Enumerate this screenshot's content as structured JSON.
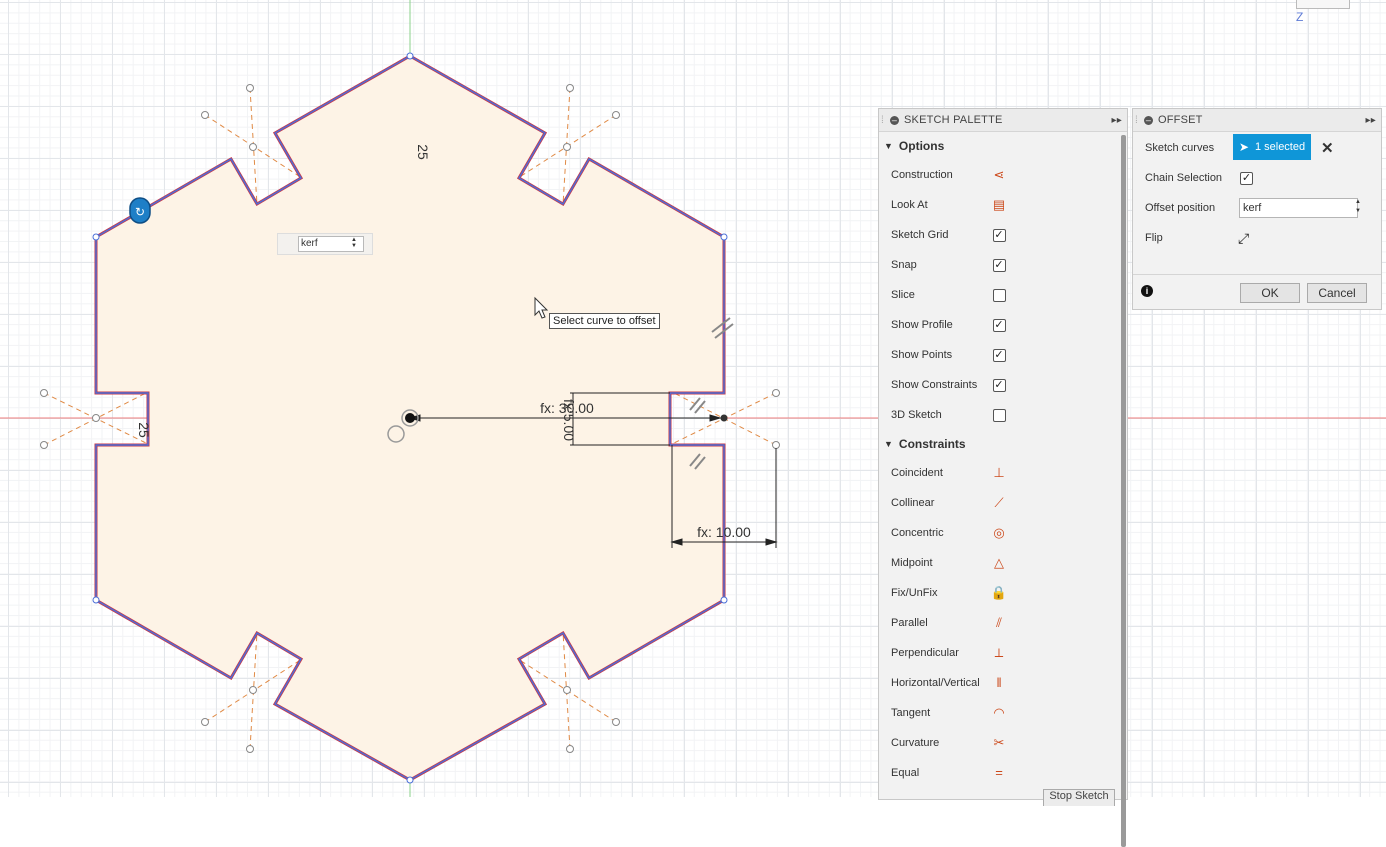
{
  "viewport": {
    "sketch_profile": "hexagonal-kerf-sketch",
    "dimension_top": "25",
    "dimension_left": "25",
    "dimension_horizontal": "fx: 30.00",
    "dimension_vertical": "fx:5.00",
    "dimension_bottom": "fx: 10.00",
    "tooltip": "Select curve to offset",
    "inline_input_value": "kerf",
    "view_cube_label": "Z"
  },
  "sketch_palette": {
    "title": "SKETCH PALETTE",
    "options_header": "Options",
    "options": [
      {
        "label": "Construction",
        "icon": "construction-icon",
        "glyph": "⋖"
      },
      {
        "label": "Look At",
        "icon": "look-at-icon",
        "glyph": "▤"
      },
      {
        "label": "Sketch Grid",
        "checked": true
      },
      {
        "label": "Snap",
        "checked": true
      },
      {
        "label": "Slice",
        "checked": false
      },
      {
        "label": "Show Profile",
        "checked": true
      },
      {
        "label": "Show Points",
        "checked": true
      },
      {
        "label": "Show Constraints",
        "checked": true
      },
      {
        "label": "3D Sketch",
        "checked": false
      }
    ],
    "constraints_header": "Constraints",
    "constraints": [
      {
        "label": "Coincident",
        "icon": "coincident-icon",
        "glyph": "⊥"
      },
      {
        "label": "Collinear",
        "icon": "collinear-icon",
        "glyph": "⟋"
      },
      {
        "label": "Concentric",
        "icon": "concentric-icon",
        "glyph": "◎"
      },
      {
        "label": "Midpoint",
        "icon": "midpoint-icon",
        "glyph": "△"
      },
      {
        "label": "Fix/UnFix",
        "icon": "lock-icon",
        "glyph": "🔒"
      },
      {
        "label": "Parallel",
        "icon": "parallel-icon",
        "glyph": "⫽"
      },
      {
        "label": "Perpendicular",
        "icon": "perpendicular-icon",
        "glyph": "⟂"
      },
      {
        "label": "Horizontal/Vertical",
        "icon": "horizontal-vertical-icon",
        "glyph": "‖"
      },
      {
        "label": "Tangent",
        "icon": "tangent-icon",
        "glyph": "◠"
      },
      {
        "label": "Curvature",
        "icon": "curvature-icon",
        "glyph": "✂"
      },
      {
        "label": "Equal",
        "icon": "equal-icon",
        "glyph": "="
      }
    ],
    "stop_button": "Stop Sketch"
  },
  "offset_dialog": {
    "title": "OFFSET",
    "sketch_curves_label": "Sketch curves",
    "selection_button": "1 selected",
    "chain_selection_label": "Chain Selection",
    "chain_selection_checked": true,
    "offset_position_label": "Offset position",
    "offset_position_value": "kerf",
    "flip_label": "Flip",
    "ok_label": "OK",
    "cancel_label": "Cancel"
  },
  "colors": {
    "profile_fill": "#fdf3e6",
    "profile_edge_blue": "#4a6fd8",
    "profile_edge_red": "#c7384a",
    "construction_orange": "#e08a45",
    "axis_green": "#7fc97f",
    "axis_red": "#e45a5a",
    "accent_blue": "#0f96d8"
  }
}
